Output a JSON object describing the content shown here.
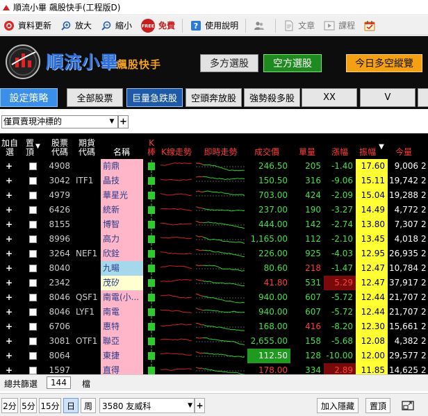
{
  "window": {
    "title": "順流小畢 飆股快手(工程版D)"
  },
  "toolbar": {
    "items": [
      {
        "label": "資料更新",
        "icon": "refresh-icon"
      },
      {
        "label": "放大",
        "icon": "zoom-in-icon"
      },
      {
        "label": "縮小",
        "icon": "zoom-out-icon"
      },
      {
        "label": "免費",
        "icon": "free-badge-icon",
        "badge": "FREE"
      },
      {
        "label": "使用說明",
        "icon": "help-icon"
      },
      {
        "label": "",
        "icon": "users-icon"
      },
      {
        "label": "文章",
        "icon": "article-icon"
      },
      {
        "label": "課程",
        "icon": "course-icon"
      },
      {
        "label": "",
        "icon": "calendar-icon"
      }
    ]
  },
  "banner": {
    "brand": "順流小畢",
    "subtitle": "飆股快手",
    "buttons": {
      "long": "多方選股",
      "short": "空方選股",
      "today": "今日多空縱覽"
    }
  },
  "strategy_button": "設定策略",
  "tabs": [
    "全部股票",
    "巨量急跌股",
    "空頭奔放股",
    "強勢殺多股",
    "XX",
    "V"
  ],
  "active_tab_index": 1,
  "filter": {
    "selected": "僅買賣現沖標的",
    "add": "+"
  },
  "table": {
    "headers": {
      "add": "加自選",
      "pin": "置頂",
      "code": "股票代碼",
      "fut": "期貨代碼",
      "name": "名稱",
      "k": "K棒",
      "kline": "K線走勢",
      "intraday": "即時走勢",
      "price": "成交價",
      "vol": "單量",
      "chg": "漲幅",
      "amp": "振幅",
      "qty": "今量"
    },
    "sort_indicator": "▼",
    "rows": [
      {
        "code": "4908",
        "fut": "",
        "name": "前鼎",
        "price": "246.50",
        "vol": "205",
        "chg": "-1.40",
        "amp": "17.60",
        "qty": "9,006",
        "name_bg": "#ffb6c8",
        "price_color": "green",
        "vol_color": "green",
        "chg_color": "green",
        "k": "green"
      },
      {
        "code": "3042",
        "fut": "ITF1",
        "name": "晶技",
        "price": "150.50",
        "vol": "316",
        "chg": "-9.06",
        "amp": "15.11",
        "qty": "19,742",
        "name_bg": "#ffb6c8",
        "price_color": "green",
        "vol_color": "green",
        "chg_color": "green",
        "k": "green"
      },
      {
        "code": "4979",
        "fut": "",
        "name": "華星光",
        "price": "703.00",
        "vol": "424",
        "chg": "-2.09",
        "amp": "15.04",
        "qty": "19,288",
        "name_bg": "#ffb6c8",
        "price_color": "green",
        "vol_color": "green",
        "chg_color": "green",
        "k": "green"
      },
      {
        "code": "6426",
        "fut": "",
        "name": "統新",
        "price": "237.00",
        "vol": "190",
        "chg": "-3.27",
        "amp": "14.49",
        "qty": "4,772",
        "name_bg": "#ffb6c8",
        "price_color": "green",
        "vol_color": "green",
        "chg_color": "green",
        "k": "green"
      },
      {
        "code": "8155",
        "fut": "",
        "name": "博智",
        "price": "444.00",
        "vol": "142",
        "chg": "-2.74",
        "amp": "13.80",
        "qty": "7,307",
        "name_bg": "#ffb6c8",
        "price_color": "green",
        "vol_color": "green",
        "chg_color": "green",
        "k": "green"
      },
      {
        "code": "8996",
        "fut": "",
        "name": "高力",
        "price": "1,165.00",
        "vol": "112",
        "chg": "-2.10",
        "amp": "13.45",
        "qty": "4,018",
        "name_bg": "#ffb6c8",
        "price_color": "green",
        "vol_color": "green",
        "chg_color": "green",
        "k": "green"
      },
      {
        "code": "3264",
        "fut": "NEF1",
        "name": "欣銓",
        "price": "226.00",
        "vol": "925",
        "chg": "-4.03",
        "amp": "12.95",
        "qty": "26,935",
        "name_bg": "#ffb6c8",
        "price_color": "green",
        "vol_color": "green",
        "chg_color": "green",
        "k": "green"
      },
      {
        "code": "8040",
        "fut": "",
        "name": "九暘",
        "price": "80.60",
        "vol": "218",
        "chg": "-1.47",
        "amp": "12.47",
        "qty": "10,784",
        "name_bg": "#a6d8ec",
        "price_color": "green",
        "vol_color": "red",
        "chg_color": "green",
        "k": "green"
      },
      {
        "code": "2342",
        "fut": "",
        "name": "茂矽",
        "price": "41.80",
        "vol": "531",
        "chg": "5.29",
        "amp": "12.47",
        "qty": "37,917",
        "name_bg": "#ffffd0",
        "price_color": "red",
        "vol_color": "green",
        "chg_color": "red-box",
        "k": "green"
      },
      {
        "code": "8046",
        "fut": "QSF1",
        "name": "南電(小...",
        "price": "940.00",
        "vol": "607",
        "chg": "-5.72",
        "amp": "12.44",
        "qty": "21,707",
        "name_bg": "#ffb6c8",
        "price_color": "green",
        "vol_color": "green",
        "chg_color": "green",
        "k": "green"
      },
      {
        "code": "8046",
        "fut": "LYF1",
        "name": "南電",
        "price": "940.00",
        "vol": "607",
        "chg": "-5.72",
        "amp": "12.44",
        "qty": "21,707",
        "name_bg": "#ffb6c8",
        "price_color": "green",
        "vol_color": "green",
        "chg_color": "green",
        "k": "green"
      },
      {
        "code": "6706",
        "fut": "",
        "name": "惠特",
        "price": "168.00",
        "vol": "416",
        "chg": "-8.20",
        "amp": "12.30",
        "qty": "15,661",
        "name_bg": "#ffb6c8",
        "price_color": "green",
        "vol_color": "red",
        "chg_color": "green",
        "k": "green"
      },
      {
        "code": "3081",
        "fut": "OTF1",
        "name": "聯亞",
        "price": "2,655.00",
        "vol": "158",
        "chg": "-5.68",
        "amp": "12.08",
        "qty": "4,382",
        "name_bg": "#ffb6c8",
        "price_color": "green",
        "vol_color": "green",
        "chg_color": "green",
        "k": "green"
      },
      {
        "code": "8064",
        "fut": "",
        "name": "東捷",
        "price": "112.50",
        "vol": "128",
        "chg": "-10.00",
        "amp": "12.00",
        "qty": "29,577",
        "name_bg": "#ffb6c8",
        "price_color": "limit-down",
        "vol_color": "green",
        "chg_color": "green",
        "k": "green"
      },
      {
        "code": "1597",
        "fut": "",
        "name": "直得",
        "price": "178.00",
        "vol": "334",
        "chg": "2.89",
        "amp": "11.85",
        "qty": "14,625",
        "name_bg": "#ffb6c8",
        "price_color": "red",
        "vol_color": "green",
        "chg_color": "red-box",
        "k": "green"
      }
    ]
  },
  "footer": {
    "total_label": "總共篩選",
    "total_count": "144",
    "unit": "檔",
    "periods": [
      "2分",
      "5分",
      "15分",
      "日",
      "周"
    ],
    "active_period": "日",
    "stock_search": "3580 友威科",
    "add_hide": "加入隱藏",
    "pin_top": "置頂"
  },
  "colors": {
    "up": "#ff3b3b",
    "down": "#46e046",
    "amp_bg": "#ffff33",
    "active_tab": "#1e5aa8",
    "brand_blue": "#2f6fd6"
  }
}
